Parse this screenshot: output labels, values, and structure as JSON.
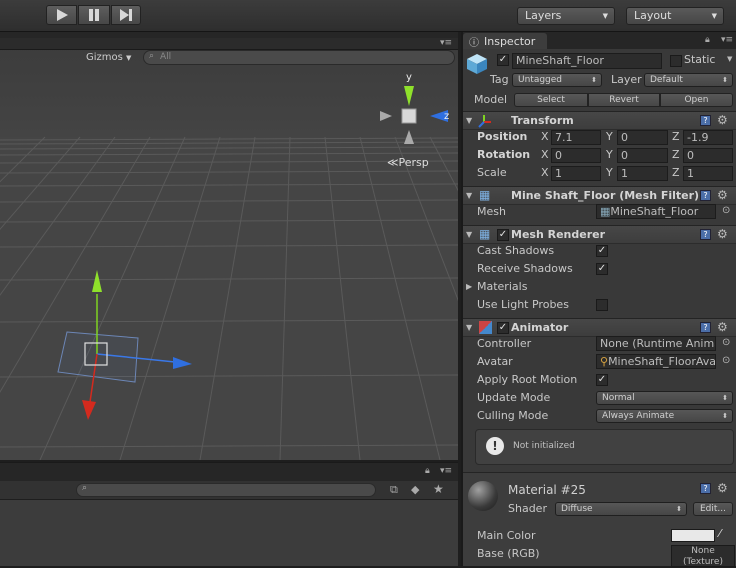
{
  "toolbar": {
    "play_icon": "play-icon",
    "pause_icon": "pause-icon",
    "step_icon": "step-icon",
    "layers_label": "Layers",
    "layout_label": "Layout"
  },
  "scene": {
    "gizmos_label": "Gizmos",
    "search_placeholder": "All",
    "persp_label": "Persp",
    "axis_y": "y",
    "axis_z": "z"
  },
  "inspector": {
    "tab_label": "Inspector",
    "object_name": "MineShaft_Floor",
    "static_label": "Static",
    "tag_label": "Tag",
    "tag_value": "Untagged",
    "layer_label": "Layer",
    "layer_value": "Default",
    "model_label": "Model",
    "select_label": "Select",
    "revert_label": "Revert",
    "open_label": "Open",
    "transform": {
      "title": "Transform",
      "position_label": "Position",
      "rotation_label": "Rotation",
      "scale_label": "Scale",
      "x": "X",
      "y": "Y",
      "z": "Z",
      "position": [
        "7.1",
        "0",
        "-1.9"
      ],
      "rotation": [
        "0",
        "0",
        "0"
      ],
      "scale": [
        "1",
        "1",
        "1"
      ]
    },
    "mesh_filter": {
      "title": "Mine Shaft_Floor (Mesh Filter)",
      "mesh_label": "Mesh",
      "mesh_value": "MineShaft_Floor"
    },
    "mesh_renderer": {
      "title": "Mesh Renderer",
      "cast_shadows_label": "Cast Shadows",
      "receive_shadows_label": "Receive Shadows",
      "materials_label": "Materials",
      "light_probes_label": "Use Light Probes"
    },
    "animator": {
      "title": "Animator",
      "controller_label": "Controller",
      "controller_value": "None (Runtime Anima",
      "avatar_label": "Avatar",
      "avatar_value": "MineShaft_FloorAva",
      "root_motion_label": "Apply Root Motion",
      "update_mode_label": "Update Mode",
      "update_mode_value": "Normal",
      "culling_mode_label": "Culling Mode",
      "culling_mode_value": "Always Animate",
      "notice": "Not initialized"
    },
    "material": {
      "title": "Material #25",
      "shader_label": "Shader",
      "shader_value": "Diffuse",
      "edit_label": "Edit...",
      "main_color_label": "Main Color",
      "base_label": "Base (RGB)",
      "texture_none": "None",
      "texture_type": "(Texture)"
    }
  },
  "colors": {
    "scene_bg": "#3a3a3a",
    "panel_bg": "#393939",
    "axis_y": "#7fd321",
    "axis_z": "#2f6fe0",
    "axis_x": "#d42a1e"
  }
}
